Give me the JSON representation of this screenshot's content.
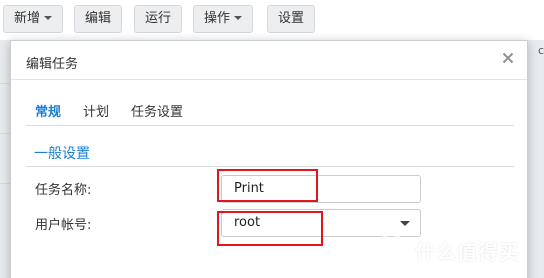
{
  "toolbar": {
    "new_label": "新增",
    "edit_label": "编辑",
    "run_label": "运行",
    "action_label": "操作",
    "settings_label": "设置"
  },
  "dialog": {
    "title": "编辑任务",
    "tabs": [
      {
        "label": "常规",
        "active": true
      },
      {
        "label": "计划",
        "active": false
      },
      {
        "label": "任务设置",
        "active": false
      }
    ],
    "section_title": "一般设置",
    "fields": {
      "task_name": {
        "label": "任务名称:",
        "value": "Print"
      },
      "user_account": {
        "label": "用户帐号:",
        "value": "root"
      }
    }
  },
  "background": {
    "edge_text": "c"
  },
  "watermark": {
    "logo_char": "值",
    "text": "什么值得买"
  },
  "colors": {
    "accent": "#1a7fd4",
    "highlight": "#e0161e",
    "toolbar_button_bg": "#eceef0"
  },
  "icons": {
    "close": "close-icon",
    "dropdown": "chevron-down-icon",
    "caret": "caret-down-icon"
  }
}
